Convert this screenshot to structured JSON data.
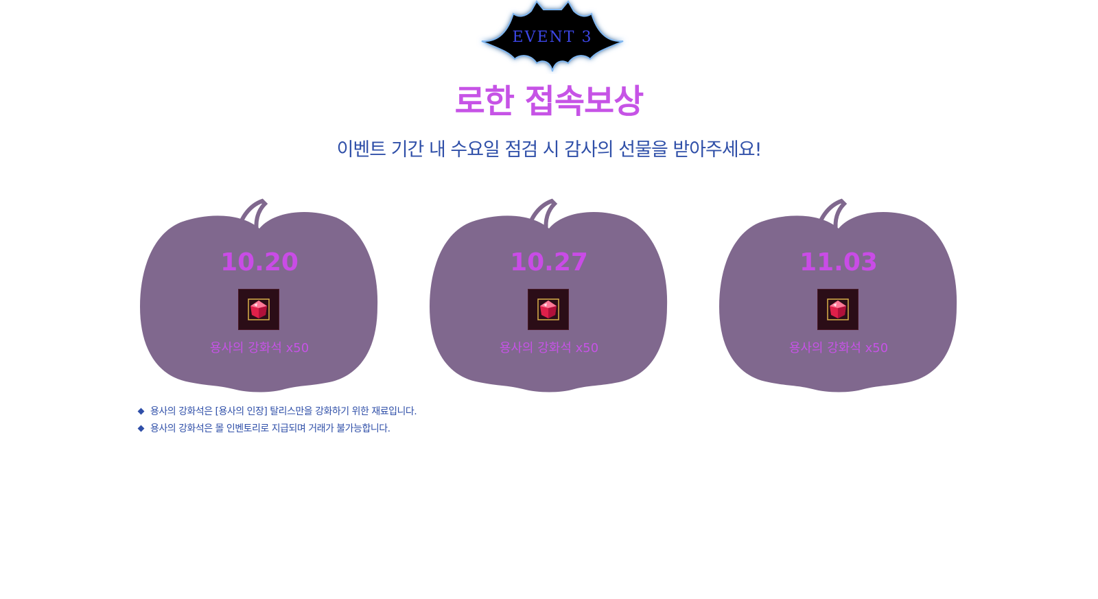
{
  "header": {
    "event_label": "EVENT 3",
    "title": "로한 접속보상",
    "subtitle": "이벤트 기간 내 수요일 점검 시 감사의 선물을 받아주세요!"
  },
  "rewards": [
    {
      "date": "10.20",
      "item_icon": "red-gem-icon",
      "item_name": "용사의 강화석 x50"
    },
    {
      "date": "10.27",
      "item_icon": "red-gem-icon",
      "item_name": "용사의 강화석 x50"
    },
    {
      "date": "11.03",
      "item_icon": "red-gem-icon",
      "item_name": "용사의 강화석 x50"
    }
  ],
  "notes": [
    "용사의 강화석은 [용사의 인장] 탈리스만을 강화하기 위한 재료입니다.",
    "용사의 강화석은 몰 인벤토리로 지급되며 거래가 불가능합니다."
  ],
  "colors": {
    "pumpkin": "#80688e",
    "accent_pink": "#c653e6",
    "accent_blue": "#2f4fa8",
    "bat": "#000000"
  }
}
